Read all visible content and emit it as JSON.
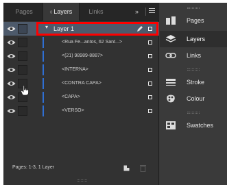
{
  "tabs": {
    "pages": "Pages",
    "layers": "Layers",
    "links": "Links",
    "collapse": "»"
  },
  "layer": {
    "name": "Layer 1",
    "items": [
      "<Rua Fe...antos, 62 Sant...>",
      "<(21) 98989-8887>",
      "<INTERNA>",
      "<CONTRA CAPA>",
      "<CAPA>",
      "<VERSO>"
    ]
  },
  "footer": {
    "status": "Pages: 1-3, 1 Layer"
  },
  "dock": {
    "items": [
      {
        "label": "Pages",
        "icon": "pages-icon"
      },
      {
        "label": "Layers",
        "icon": "layers-icon"
      },
      {
        "label": "Links",
        "icon": "links-icon"
      },
      {
        "label": "Stroke",
        "icon": "stroke-icon"
      },
      {
        "label": "Colour",
        "icon": "colour-icon"
      },
      {
        "label": "Swatches",
        "icon": "swatches-icon"
      }
    ]
  },
  "colors": {
    "highlight_box": "#ff0000",
    "layer_color_bar": "#2f6fd3",
    "selected_row": "#4d5a6b",
    "panel_bg": "#323232"
  }
}
